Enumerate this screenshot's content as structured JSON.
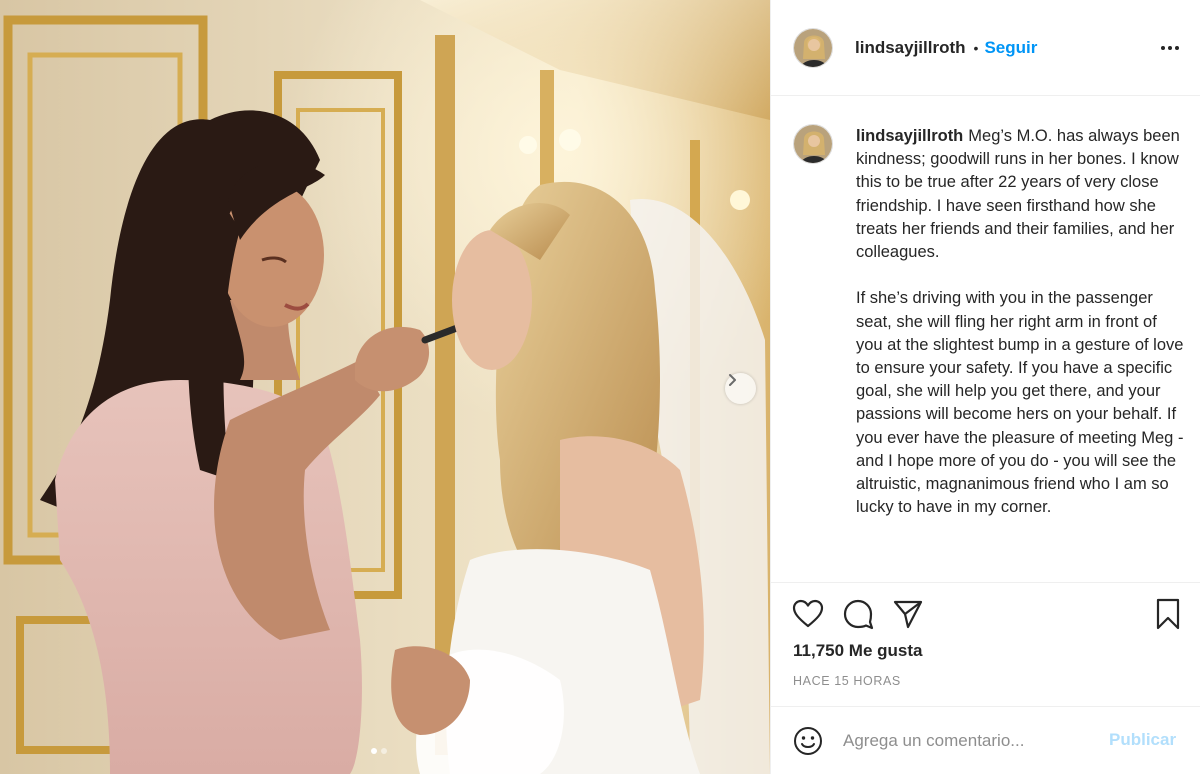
{
  "header": {
    "username": "lindsayjillroth",
    "separator": "•",
    "follow_label": "Seguir",
    "more_icon": "more-options-icon"
  },
  "caption": {
    "username": "lindsayjillroth",
    "paragraph1": "Meg’s M.O. has always been kindness; goodwill runs in her bones. I know this to be true after 22 years of very close friendship. I have seen firsthand how she treats her friends and their families, and her colleagues.",
    "paragraph2": "If she’s driving with you in the passenger seat, she will fling her right arm in front of you at the slightest bump in a gesture of love to ensure your safety. If you have a specific goal, she will help you get there, and your passions will become hers on your behalf. If you ever have the pleasure of meeting Meg - and I hope more of you do - you will see the altruistic, magnanimous friend who I am so lucky to have in my corner."
  },
  "actions": {
    "like_icon": "heart-icon",
    "comment_icon": "comment-icon",
    "share_icon": "share-icon",
    "save_icon": "bookmark-icon"
  },
  "stats": {
    "likes": "11,750 Me gusta",
    "time_ago": "HACE 15 HORAS"
  },
  "comment_box": {
    "placeholder": "Agrega un comentario...",
    "publish_label": "Publicar",
    "emoji_icon": "emoji-icon"
  },
  "carousel": {
    "current_slide": 1,
    "total_slides": 2,
    "next_icon": "chevron-right-icon"
  },
  "colors": {
    "link_blue": "#0095f6",
    "publish_disabled": "#b2dffc",
    "text": "#262626",
    "muted": "#8e8e8e",
    "border": "#efefef"
  }
}
